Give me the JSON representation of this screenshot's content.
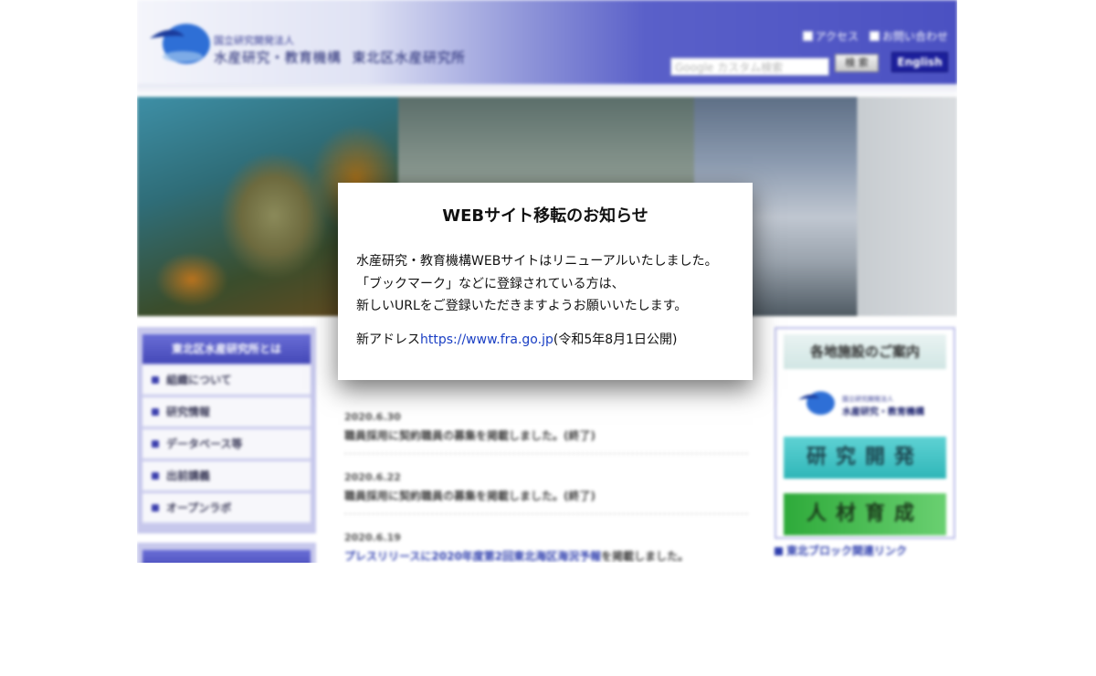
{
  "header": {
    "org_small": "国立研究開発法人",
    "org_name": "水産研究・教育機構",
    "lab_name": "東北区水産研究所",
    "links": [
      "アクセス",
      "お問い合わせ"
    ],
    "search_placeholder": "Google カスタム検索",
    "search_button": "検 索",
    "english_button": "English"
  },
  "sidebar": {
    "title": "東北区水産研究所とは",
    "items": [
      {
        "label": "組織について"
      },
      {
        "label": "研究情報"
      },
      {
        "label": "データベース等"
      },
      {
        "label": "出前講義"
      },
      {
        "label": "オープンラボ"
      }
    ]
  },
  "news": [
    {
      "date": "2020.6.30",
      "text": "職員採用に契約職員の募集を掲載しました。(終了)"
    },
    {
      "date": "2020.6.22",
      "text": "職員採用に契約職員の募集を掲載しました。(終了)"
    },
    {
      "date": "2020.6.19",
      "text_link": "プレスリリースに2020年度第2回東北海区海況予報",
      "text_rest": "を掲載しました。"
    }
  ],
  "right": {
    "title": "各地施設のご案内",
    "logo_small": "国立研究開発法人",
    "logo_name": "水産研究・教育機構",
    "button_research": "研究開発",
    "button_training": "人材育成",
    "link_block": "東北ブロック関連リンク"
  },
  "modal": {
    "title": "WEBサイト移転のお知らせ",
    "line1": "水産研究・教育機構WEBサイトはリニューアルいたしました。",
    "line2": "「ブックマーク」などに登録されている方は、",
    "line3": "新しいURLをご登録いただきますようお願いいたします。",
    "addr_prefix": "新アドレス",
    "addr_url": "https://www.fra.go.jp",
    "addr_suffix": "(令和5年8月1日公開)"
  },
  "colors": {
    "header_blue": "#4b51c2",
    "nav_title": "#4448b8",
    "research_cyan": "#2fb6b8",
    "training_green": "#2eaa3a",
    "link_blue": "#1a3fc4"
  }
}
